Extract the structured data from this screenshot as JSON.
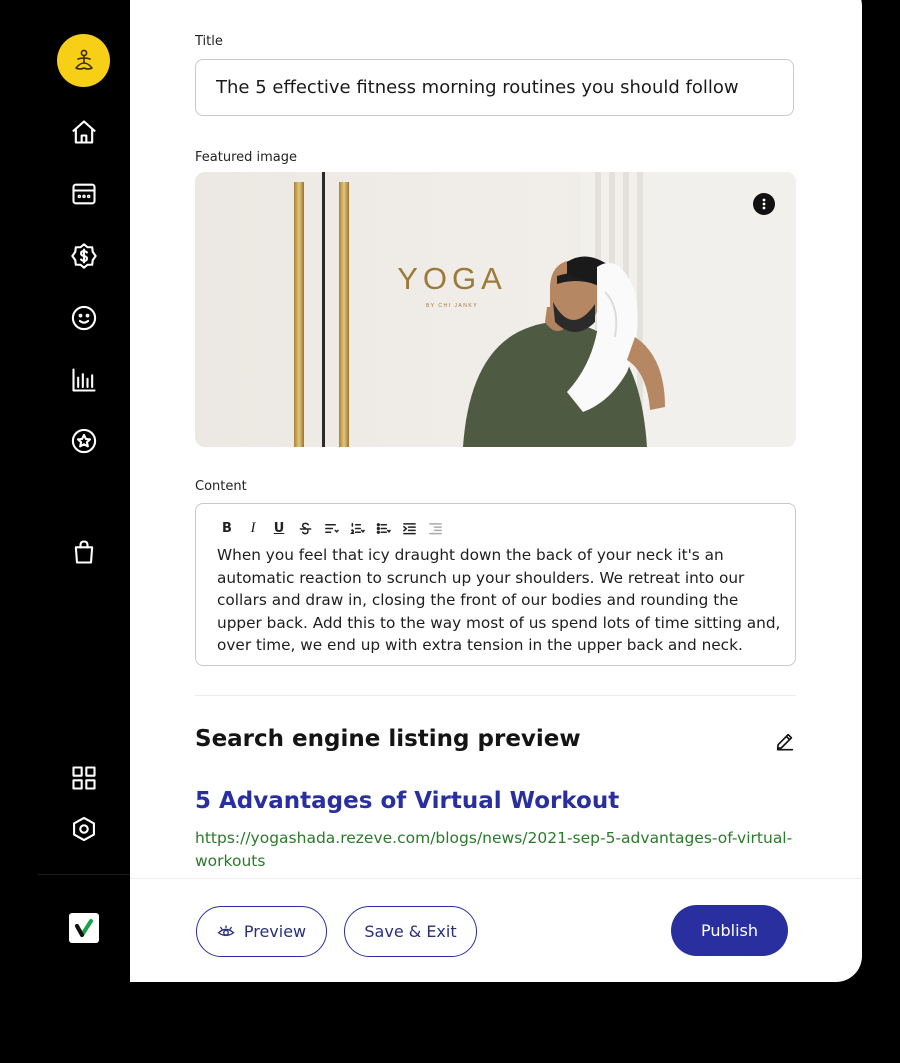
{
  "colors": {
    "accent": "#2a2fa0",
    "logo_bg": "#f7cf17",
    "link_green": "#2b7a2b"
  },
  "sidebar": {
    "items": [
      {
        "icon": "home-icon"
      },
      {
        "icon": "calendar-icon"
      },
      {
        "icon": "dollar-badge-icon"
      },
      {
        "icon": "smiley-icon"
      },
      {
        "icon": "bar-chart-icon"
      },
      {
        "icon": "star-circle-icon"
      },
      {
        "icon": "shopping-bag-icon"
      },
      {
        "icon": "apps-grid-icon"
      },
      {
        "icon": "settings-hex-icon"
      }
    ]
  },
  "form": {
    "title_label": "Title",
    "title_value": "The 5 effective fitness morning routines you should follow",
    "image_label": "Featured image",
    "image_text": "YOGA",
    "image_subtext": "BY CHI JANKY",
    "content_label": "Content",
    "content_text": "When you feel that icy draught down the back of your neck it's an automatic reaction to scrunch up your shoulders. We retreat into our collars and draw in, closing the front of our bodies and rounding the upper back. Add this to the way most of us spend lots of time sitting and, over time, we end up with extra tension in the upper back and neck.",
    "toolbar": {
      "bold": "B",
      "italic": "I",
      "underline": "U"
    }
  },
  "seo": {
    "heading": "Search engine listing preview",
    "title": "5 Advantages of Virtual Workout",
    "url": "https://yogashada.rezeve.com/blogs/news/2021-sep-5-advantages-of-virtual-workouts"
  },
  "footer": {
    "preview_label": "Preview",
    "save_exit_label": "Save & Exit",
    "publish_label": "Publish"
  }
}
